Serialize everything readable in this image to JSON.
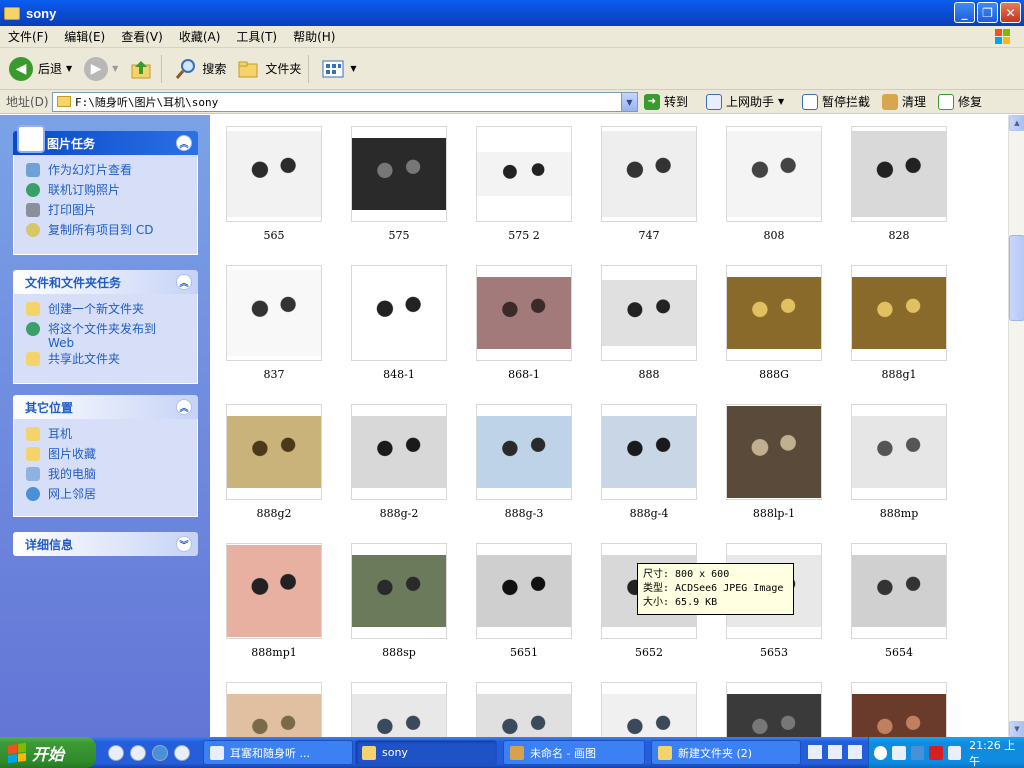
{
  "window": {
    "title": "sony"
  },
  "menu": [
    "文件(F)",
    "编辑(E)",
    "查看(V)",
    "收藏(A)",
    "工具(T)",
    "帮助(H)"
  ],
  "toolbar": {
    "back": "后退",
    "search": "搜索",
    "folders": "文件夹"
  },
  "address": {
    "label": "地址(D)",
    "path": "F:\\随身听\\图片\\耳机\\sony",
    "go": "转到",
    "extras": [
      "上网助手",
      "暂停拦截",
      "清理",
      "修复"
    ]
  },
  "left_pane": {
    "picture_tasks": {
      "title": "图片任务",
      "items": [
        "作为幻灯片查看",
        "联机订购照片",
        "打印图片",
        "复制所有项目到 CD"
      ]
    },
    "file_tasks": {
      "title": "文件和文件夹任务",
      "items": [
        "创建一个新文件夹",
        "将这个文件夹发布到 Web",
        "共享此文件夹"
      ]
    },
    "other_places": {
      "title": "其它位置",
      "items": [
        "耳机",
        "图片收藏",
        "我的电脑",
        "网上邻居"
      ]
    },
    "details": {
      "title": "详细信息"
    }
  },
  "thumbnails": [
    "565",
    "575",
    "575 2",
    "747",
    "808",
    "828",
    "837",
    "848-1",
    "868-1",
    "888",
    "888G",
    "888g1",
    "888g2",
    "888g-2",
    "888g-3",
    "888g-4",
    "888lp-1",
    "888mp",
    "888mp1",
    "888sp",
    "5651",
    "5652",
    "5653",
    "5654",
    "",
    "",
    "",
    "",
    "",
    ""
  ],
  "tooltip": {
    "size": "尺寸: 800 x 600",
    "type": "类型: ACDSee6 JPEG Image",
    "filesize": "大小: 65.9 KB"
  },
  "taskbar": {
    "start": "开始",
    "tasks": [
      "耳塞和随身听 ...",
      "sony",
      "未命名 - 画图",
      "新建文件夹 (2)"
    ],
    "clock": "21:26 上午"
  }
}
